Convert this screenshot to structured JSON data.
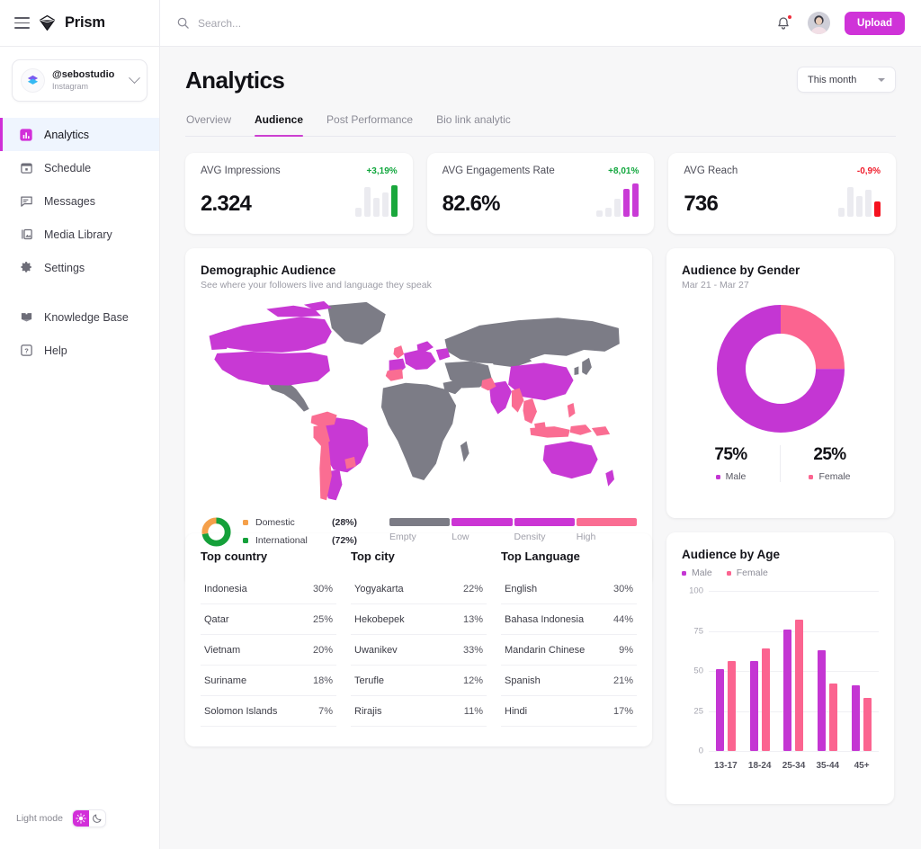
{
  "brand": {
    "name": "Prism",
    "logo_icon": "prism-diamond-icon",
    "menu_icon": "hamburger-icon"
  },
  "account": {
    "handle": "@sebostudio",
    "platform": "Instagram",
    "chevron_icon": "chevron-down-icon",
    "avatar_icon": "layers-avatar-icon"
  },
  "sidebar": {
    "items": [
      {
        "label": "Analytics",
        "icon": "bar-chart-icon",
        "active": true
      },
      {
        "label": "Schedule",
        "icon": "calendar-icon",
        "active": false
      },
      {
        "label": "Messages",
        "icon": "message-icon",
        "active": false
      },
      {
        "label": "Media Library",
        "icon": "image-icon",
        "active": false
      },
      {
        "label": "Settings",
        "icon": "gear-icon",
        "active": false
      }
    ],
    "secondary_items": [
      {
        "label": "Knowledge Base",
        "icon": "book-icon"
      },
      {
        "label": "Help",
        "icon": "question-badge-icon"
      }
    ],
    "mode": {
      "label": "Light mode",
      "sun_icon": "sun-icon",
      "moon_icon": "moon-icon",
      "active": "sun",
      "accent": "#d22fd9"
    }
  },
  "topbar": {
    "search_placeholder": "Search...",
    "search_value": "",
    "search_icon": "search-icon",
    "bell_icon": "bell-icon",
    "has_notification": true,
    "avatar_icon": "user-avatar",
    "upload_label": "Upload",
    "upload_color": "#cf33d8"
  },
  "page": {
    "title": "Analytics",
    "range_value": "This month",
    "tabs": [
      {
        "label": "Overview",
        "active": false
      },
      {
        "label": "Audience",
        "active": true
      },
      {
        "label": "Post Performance",
        "active": false
      },
      {
        "label": "Bio link analytic",
        "active": false
      }
    ]
  },
  "stats": [
    {
      "label": "AVG Impressions",
      "delta": "+3,19%",
      "delta_color": "#12a73e",
      "value": "2.324",
      "spark_color": "#1aa73c",
      "spark": [
        18,
        62,
        40,
        52,
        66
      ],
      "highlight_index": 4
    },
    {
      "label": "AVG Engagements Rate",
      "delta": "+8,01%",
      "delta_color": "#12a73e",
      "value": "82.6%",
      "spark_color": "#c93bd6",
      "spark": [
        13,
        18,
        38,
        60,
        70
      ],
      "highlight_index": 3,
      "highlight_index2": 4
    },
    {
      "label": "AVG Reach",
      "delta": "-0,9%",
      "delta_color": "#f01c2b",
      "value": "736",
      "spark_color": "#f5121f",
      "spark": [
        18,
        62,
        44,
        58,
        32
      ],
      "highlight_index": 4
    }
  ],
  "demographic": {
    "title": "Demographic Audience",
    "subtitle": "See where your followers live and language they speak",
    "legend": [
      {
        "name": "Domestic",
        "value": "(28%)",
        "color": "#f5a04a"
      },
      {
        "name": "International",
        "value": "(72%)",
        "color": "#15a03a"
      }
    ],
    "scale": [
      {
        "label": "Empty",
        "color": "#7b7b85"
      },
      {
        "label": "Low",
        "color": "#cb35d4"
      },
      {
        "label": "Density",
        "color": "#cb35d4"
      },
      {
        "label": "High",
        "color": "#fa6d92"
      }
    ],
    "map_colors": {
      "base": "#7c7c86",
      "mid": "#c839d4",
      "high": "#fa6d92"
    }
  },
  "tops": [
    {
      "title": "Top country",
      "rows": [
        {
          "name": "Indonesia",
          "value": "30%"
        },
        {
          "name": "Qatar",
          "value": "25%"
        },
        {
          "name": "Vietnam",
          "value": "20%"
        },
        {
          "name": "Suriname",
          "value": "18%"
        },
        {
          "name": "Solomon Islands",
          "value": "7%"
        }
      ]
    },
    {
      "title": "Top city",
      "rows": [
        {
          "name": "Yogyakarta",
          "value": "22%"
        },
        {
          "name": "Hekobepek",
          "value": "13%"
        },
        {
          "name": "Uwanikev",
          "value": "33%"
        },
        {
          "name": "Terufle",
          "value": "12%"
        },
        {
          "name": "Rirajis",
          "value": "11%"
        }
      ]
    },
    {
      "title": "Top Language",
      "rows": [
        {
          "name": "English",
          "value": "30%"
        },
        {
          "name": "Bahasa Indonesia",
          "value": "44%"
        },
        {
          "name": "Mandarin Chinese",
          "value": "9%"
        },
        {
          "name": "Spanish",
          "value": "21%"
        },
        {
          "name": "Hindi",
          "value": "17%"
        }
      ]
    }
  ],
  "gender": {
    "title": "Audience by Gender",
    "date_range": "Mar 21 - Mar 27",
    "male_pct": "75%",
    "female_pct": "25%",
    "male_label": "Male",
    "female_label": "Female",
    "male_color": "#c436d3",
    "female_color": "#fb6490"
  },
  "age": {
    "title": "Audience by Age",
    "legend": [
      {
        "label": "Male",
        "color": "#c436d3"
      },
      {
        "label": "Female",
        "color": "#fb6490"
      }
    ]
  },
  "chart_data": [
    {
      "type": "pie",
      "title": "Audience by Gender",
      "subtitle": "Mar 21 - Mar 27",
      "labels": [
        "Male",
        "Female"
      ],
      "values": [
        75,
        25
      ],
      "colors": [
        "#c436d3",
        "#fb6490"
      ],
      "legend": "bottom",
      "donut": true
    },
    {
      "type": "bar",
      "title": "Audience by Age",
      "categories": [
        "13-17",
        "18-24",
        "25-34",
        "35-44",
        "45+"
      ],
      "series": [
        {
          "name": "Male",
          "values": [
            51,
            56,
            76,
            63,
            41
          ],
          "color": "#c436d3"
        },
        {
          "name": "Female",
          "values": [
            56,
            64,
            82,
            42,
            33
          ],
          "color": "#fb6490"
        }
      ],
      "xlabel": "",
      "ylabel": "",
      "ylim": [
        0,
        100
      ],
      "yticks": [
        0,
        25,
        50,
        75,
        100
      ],
      "grid": true,
      "legend": "top"
    },
    {
      "type": "pie",
      "title": "Domestic vs International",
      "labels": [
        "Domestic",
        "International"
      ],
      "values": [
        28,
        72
      ],
      "colors": [
        "#f5a04a",
        "#15a03a"
      ],
      "donut": true
    },
    {
      "type": "bar",
      "title": "AVG Impressions sparkline",
      "categories": [
        "1",
        "2",
        "3",
        "4",
        "5"
      ],
      "values": [
        18,
        62,
        40,
        52,
        66
      ],
      "ylim": [
        0,
        70
      ]
    },
    {
      "type": "bar",
      "title": "AVG Engagements Rate sparkline",
      "categories": [
        "1",
        "2",
        "3",
        "4",
        "5"
      ],
      "values": [
        13,
        18,
        38,
        60,
        70
      ],
      "ylim": [
        0,
        70
      ]
    },
    {
      "type": "bar",
      "title": "AVG Reach sparkline",
      "categories": [
        "1",
        "2",
        "3",
        "4",
        "5"
      ],
      "values": [
        18,
        62,
        44,
        58,
        32
      ],
      "ylim": [
        0,
        70
      ]
    },
    {
      "type": "table",
      "title": "Top country",
      "categories": [
        "Indonesia",
        "Qatar",
        "Vietnam",
        "Suriname",
        "Solomon Islands"
      ],
      "values": [
        30,
        25,
        20,
        18,
        7
      ]
    },
    {
      "type": "table",
      "title": "Top city",
      "categories": [
        "Yogyakarta",
        "Hekobepek",
        "Uwanikev",
        "Terufle",
        "Rirajis"
      ],
      "values": [
        22,
        13,
        33,
        12,
        11
      ]
    },
    {
      "type": "table",
      "title": "Top Language",
      "categories": [
        "English",
        "Bahasa Indonesia",
        "Mandarin Chinese",
        "Spanish",
        "Hindi"
      ],
      "values": [
        30,
        44,
        9,
        21,
        17
      ]
    }
  ]
}
